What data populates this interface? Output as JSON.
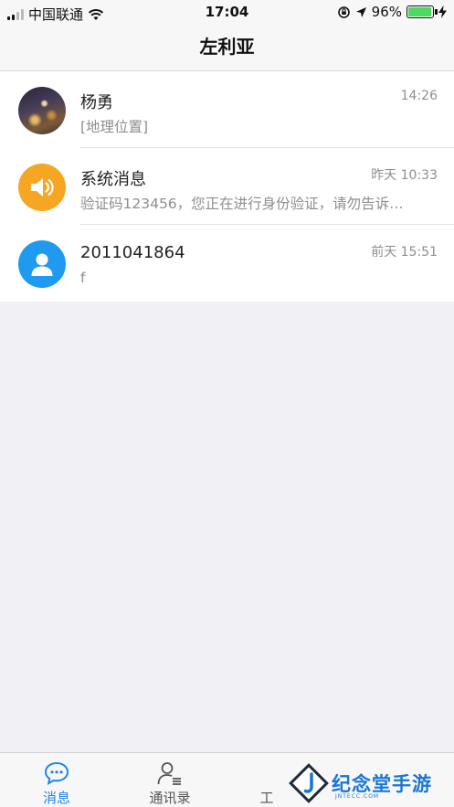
{
  "status_bar": {
    "carrier": "中国联通",
    "time": "17:04",
    "battery_percent": "96%",
    "battery_level": 0.96,
    "signal_bars_filled": 2,
    "signal_bars_total": 4
  },
  "nav": {
    "title": "左利亚"
  },
  "conversations": [
    {
      "name": "杨勇",
      "time": "14:26",
      "preview": "[地理位置]",
      "avatar": "photo-avatar"
    },
    {
      "name": "系统消息",
      "time": "昨天 10:33",
      "preview": "验证码123456，您正在进行身份验证，请勿告诉…",
      "avatar": "speaker-icon"
    },
    {
      "name": "2011041864",
      "time": "前天 15:51",
      "preview": "f",
      "avatar": "person-icon"
    }
  ],
  "tabs": [
    {
      "label": "消息",
      "icon": "chat-bubble-icon",
      "active": true
    },
    {
      "label": "通讯录",
      "icon": "contacts-icon",
      "active": false
    },
    {
      "label": "工",
      "icon": "work-icon",
      "active": false
    }
  ],
  "watermark": {
    "text": "纪念堂手游",
    "subtext": "JNTECC.COM"
  },
  "colors": {
    "accent": "#1e88e5",
    "orange": "#f5a623",
    "blue_avatar": "#1e9bf0",
    "battery": "#4cd964"
  }
}
